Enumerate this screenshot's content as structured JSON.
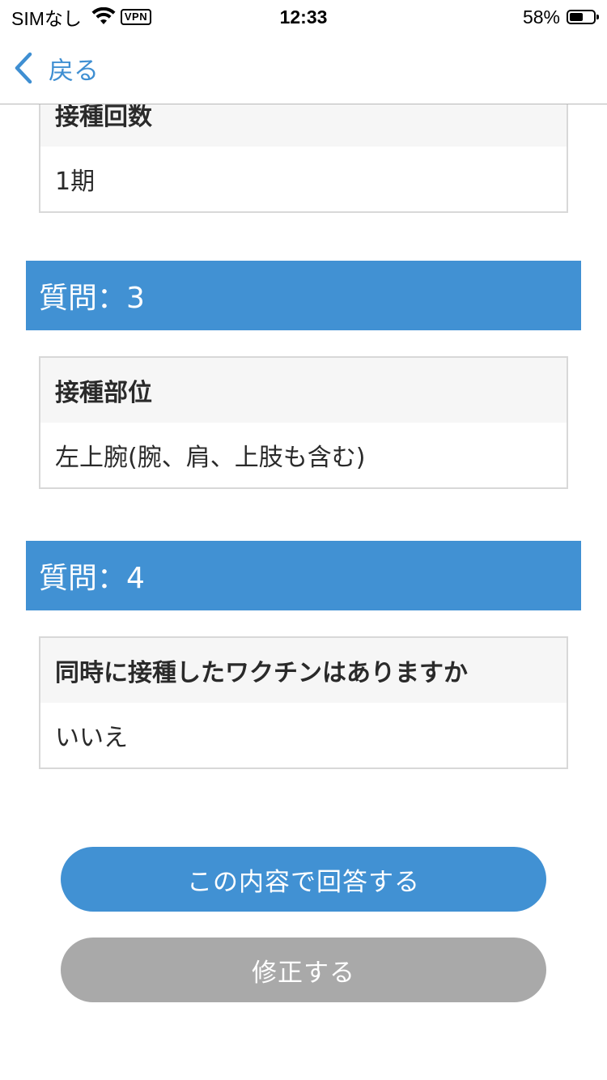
{
  "status_bar": {
    "carrier": "SIMなし",
    "vpn": "VPN",
    "time": "12:33",
    "battery": "58%",
    "battery_level": 0.58
  },
  "nav": {
    "back_label": "戻る"
  },
  "sections": [
    {
      "question": "",
      "label": "接種回数",
      "value": "1期"
    },
    {
      "question": "質問：3",
      "label": "接種部位",
      "value": "左上腕(腕、肩、上肢も含む)"
    },
    {
      "question": "質問：4",
      "label": "同時に接種したワクチンはありますか",
      "value": "いいえ"
    }
  ],
  "buttons": {
    "submit_label": "この内容で回答する",
    "edit_label": "修正する"
  },
  "colors": {
    "accent": "#4191d3",
    "secondary_button": "#a9a9a9",
    "answer_head_bg": "#f6f6f6"
  },
  "icons": {
    "back": "chevron-left-icon",
    "wifi": "wifi-icon",
    "battery": "battery-icon"
  }
}
